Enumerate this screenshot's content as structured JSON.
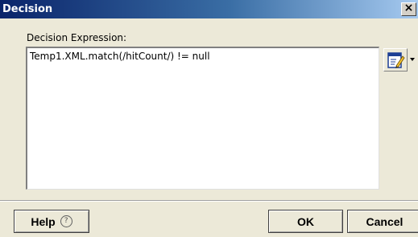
{
  "window": {
    "title": "Decision",
    "close_glyph": "×"
  },
  "expression": {
    "label": "Decision Expression:",
    "value": "Temp1.XML.match(/hitCount/) != null"
  },
  "toolbar": {
    "edit_icon": "edit-expression-icon",
    "dropdown_icon": "dropdown-arrow-icon"
  },
  "buttons": {
    "help_label": "Help",
    "help_icon_glyph": "?",
    "ok_label": "OK",
    "cancel_label": "Cancel"
  },
  "colors": {
    "titlebar_start": "#0a246a",
    "titlebar_end": "#a6caf0",
    "dialog_background": "#ece9d8"
  }
}
